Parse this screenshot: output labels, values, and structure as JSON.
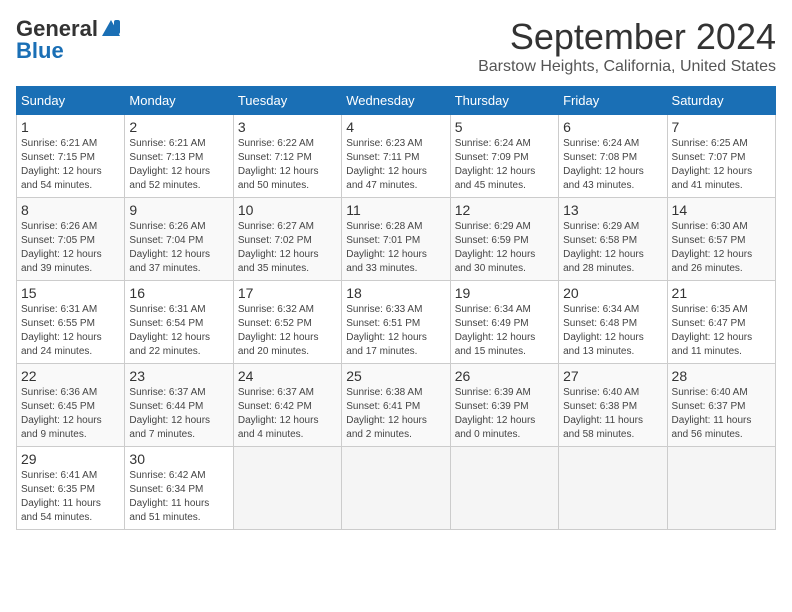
{
  "header": {
    "logo_general": "General",
    "logo_blue": "Blue",
    "month": "September 2024",
    "location": "Barstow Heights, California, United States"
  },
  "calendar": {
    "days_of_week": [
      "Sunday",
      "Monday",
      "Tuesday",
      "Wednesday",
      "Thursday",
      "Friday",
      "Saturday"
    ],
    "weeks": [
      [
        {
          "day": "1",
          "sunrise": "6:21 AM",
          "sunset": "7:15 PM",
          "daylight": "12 hours and 54 minutes."
        },
        {
          "day": "2",
          "sunrise": "6:21 AM",
          "sunset": "7:13 PM",
          "daylight": "12 hours and 52 minutes."
        },
        {
          "day": "3",
          "sunrise": "6:22 AM",
          "sunset": "7:12 PM",
          "daylight": "12 hours and 50 minutes."
        },
        {
          "day": "4",
          "sunrise": "6:23 AM",
          "sunset": "7:11 PM",
          "daylight": "12 hours and 47 minutes."
        },
        {
          "day": "5",
          "sunrise": "6:24 AM",
          "sunset": "7:09 PM",
          "daylight": "12 hours and 45 minutes."
        },
        {
          "day": "6",
          "sunrise": "6:24 AM",
          "sunset": "7:08 PM",
          "daylight": "12 hours and 43 minutes."
        },
        {
          "day": "7",
          "sunrise": "6:25 AM",
          "sunset": "7:07 PM",
          "daylight": "12 hours and 41 minutes."
        }
      ],
      [
        {
          "day": "8",
          "sunrise": "6:26 AM",
          "sunset": "7:05 PM",
          "daylight": "12 hours and 39 minutes."
        },
        {
          "day": "9",
          "sunrise": "6:26 AM",
          "sunset": "7:04 PM",
          "daylight": "12 hours and 37 minutes."
        },
        {
          "day": "10",
          "sunrise": "6:27 AM",
          "sunset": "7:02 PM",
          "daylight": "12 hours and 35 minutes."
        },
        {
          "day": "11",
          "sunrise": "6:28 AM",
          "sunset": "7:01 PM",
          "daylight": "12 hours and 33 minutes."
        },
        {
          "day": "12",
          "sunrise": "6:29 AM",
          "sunset": "6:59 PM",
          "daylight": "12 hours and 30 minutes."
        },
        {
          "day": "13",
          "sunrise": "6:29 AM",
          "sunset": "6:58 PM",
          "daylight": "12 hours and 28 minutes."
        },
        {
          "day": "14",
          "sunrise": "6:30 AM",
          "sunset": "6:57 PM",
          "daylight": "12 hours and 26 minutes."
        }
      ],
      [
        {
          "day": "15",
          "sunrise": "6:31 AM",
          "sunset": "6:55 PM",
          "daylight": "12 hours and 24 minutes."
        },
        {
          "day": "16",
          "sunrise": "6:31 AM",
          "sunset": "6:54 PM",
          "daylight": "12 hours and 22 minutes."
        },
        {
          "day": "17",
          "sunrise": "6:32 AM",
          "sunset": "6:52 PM",
          "daylight": "12 hours and 20 minutes."
        },
        {
          "day": "18",
          "sunrise": "6:33 AM",
          "sunset": "6:51 PM",
          "daylight": "12 hours and 17 minutes."
        },
        {
          "day": "19",
          "sunrise": "6:34 AM",
          "sunset": "6:49 PM",
          "daylight": "12 hours and 15 minutes."
        },
        {
          "day": "20",
          "sunrise": "6:34 AM",
          "sunset": "6:48 PM",
          "daylight": "12 hours and 13 minutes."
        },
        {
          "day": "21",
          "sunrise": "6:35 AM",
          "sunset": "6:47 PM",
          "daylight": "12 hours and 11 minutes."
        }
      ],
      [
        {
          "day": "22",
          "sunrise": "6:36 AM",
          "sunset": "6:45 PM",
          "daylight": "12 hours and 9 minutes."
        },
        {
          "day": "23",
          "sunrise": "6:37 AM",
          "sunset": "6:44 PM",
          "daylight": "12 hours and 7 minutes."
        },
        {
          "day": "24",
          "sunrise": "6:37 AM",
          "sunset": "6:42 PM",
          "daylight": "12 hours and 4 minutes."
        },
        {
          "day": "25",
          "sunrise": "6:38 AM",
          "sunset": "6:41 PM",
          "daylight": "12 hours and 2 minutes."
        },
        {
          "day": "26",
          "sunrise": "6:39 AM",
          "sunset": "6:39 PM",
          "daylight": "12 hours and 0 minutes."
        },
        {
          "day": "27",
          "sunrise": "6:40 AM",
          "sunset": "6:38 PM",
          "daylight": "11 hours and 58 minutes."
        },
        {
          "day": "28",
          "sunrise": "6:40 AM",
          "sunset": "6:37 PM",
          "daylight": "11 hours and 56 minutes."
        }
      ],
      [
        {
          "day": "29",
          "sunrise": "6:41 AM",
          "sunset": "6:35 PM",
          "daylight": "11 hours and 54 minutes."
        },
        {
          "day": "30",
          "sunrise": "6:42 AM",
          "sunset": "6:34 PM",
          "daylight": "11 hours and 51 minutes."
        },
        null,
        null,
        null,
        null,
        null
      ]
    ]
  }
}
